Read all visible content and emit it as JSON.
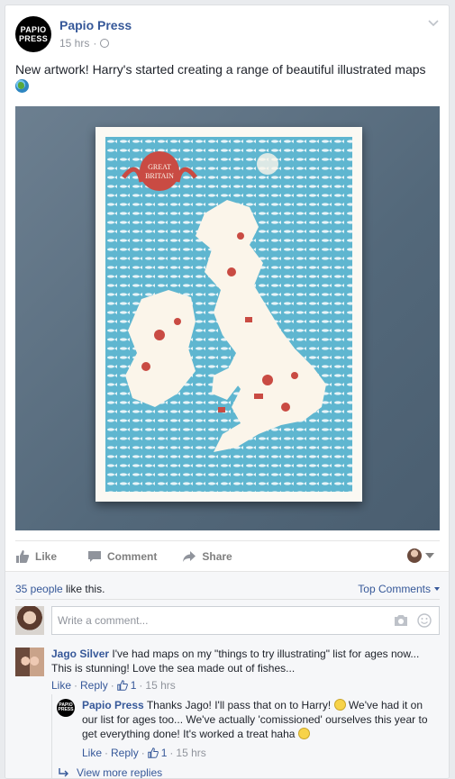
{
  "post": {
    "page_name": "Papio Press",
    "page_logo_text_line1": "PAPIO",
    "page_logo_text_line2": "PRESS",
    "time": "15 hrs",
    "separator": "·",
    "text": "New artwork! Harry's started creating a range of beautiful illustrated maps",
    "poster_title_line1": "GREAT",
    "poster_title_line2": "BRITAIN"
  },
  "actions": {
    "like": "Like",
    "comment": "Comment",
    "share": "Share"
  },
  "engagement": {
    "likes_link": "35 people",
    "likes_suffix": " like this.",
    "sort_label": "Top Comments"
  },
  "composer": {
    "placeholder": "Write a comment..."
  },
  "comments": [
    {
      "author": "Jago Silver",
      "text": "I've had maps on my \"things to try illustrating\" list for ages now... This is stunning! Love the sea made out of fishes...",
      "like": "Like",
      "reply": "Reply",
      "dot": "·",
      "likes": "1",
      "time": "15 hrs"
    }
  ],
  "reply": {
    "author": "Papio Press",
    "text_part1": "Thanks Jago! I'll pass that on to Harry!",
    "text_part2": "We've had it on our list for ages too... We've actually 'comissioned' ourselves this year to get everything done! It's worked a treat haha",
    "like": "Like",
    "reply": "Reply",
    "dot": "·",
    "likes": "1",
    "time": "15 hrs"
  },
  "view_more": "View more replies",
  "colors": {
    "link": "#365899",
    "muted": "#90949c",
    "map_sea": "#5fb6d0",
    "map_land": "#fbf5ea",
    "map_accent": "#c94b43"
  }
}
